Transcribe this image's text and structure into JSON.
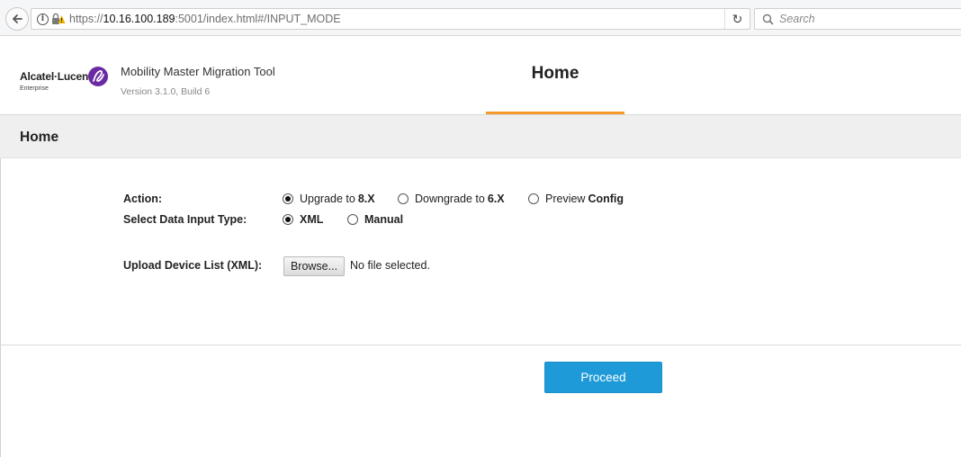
{
  "browser": {
    "url_scheme": "https://",
    "url_host": "10.16.100.189",
    "url_rest": ":5001/index.html#/INPUT_MODE",
    "search_placeholder": "Search",
    "info_glyph": "i",
    "reload_glyph": "↻",
    "icons": [
      "back-arrow-icon",
      "info-icon",
      "lock-warning-icon",
      "reload-icon",
      "search-icon"
    ]
  },
  "header": {
    "logo_name": "Alcatel·Lucent",
    "logo_sub": "Enterprise",
    "tool_title": "Mobility Master Migration Tool",
    "tool_version": "Version 3.1.0, Build 6",
    "home_tab": "Home"
  },
  "section": {
    "title": "Home"
  },
  "form": {
    "action_label": "Action:",
    "action_options": [
      {
        "text": "Upgrade to ",
        "bold": "8.X",
        "checked": true
      },
      {
        "text": "Downgrade to ",
        "bold": "6.X",
        "checked": false
      },
      {
        "text": "Preview ",
        "bold": "Config",
        "checked": false
      }
    ],
    "input_type_label": "Select Data Input Type:",
    "input_type_options": [
      {
        "text": "",
        "bold": "XML",
        "checked": true
      },
      {
        "text": "",
        "bold": "Manual",
        "checked": false
      }
    ],
    "upload_label": "Upload Device List (XML):",
    "browse_label": "Browse...",
    "file_status": "No file selected."
  },
  "footer": {
    "proceed_label": "Proceed"
  },
  "colors": {
    "accent_orange": "#f39a2b",
    "button_blue": "#1e9ad8",
    "logo_purple": "#6a2aa3"
  }
}
